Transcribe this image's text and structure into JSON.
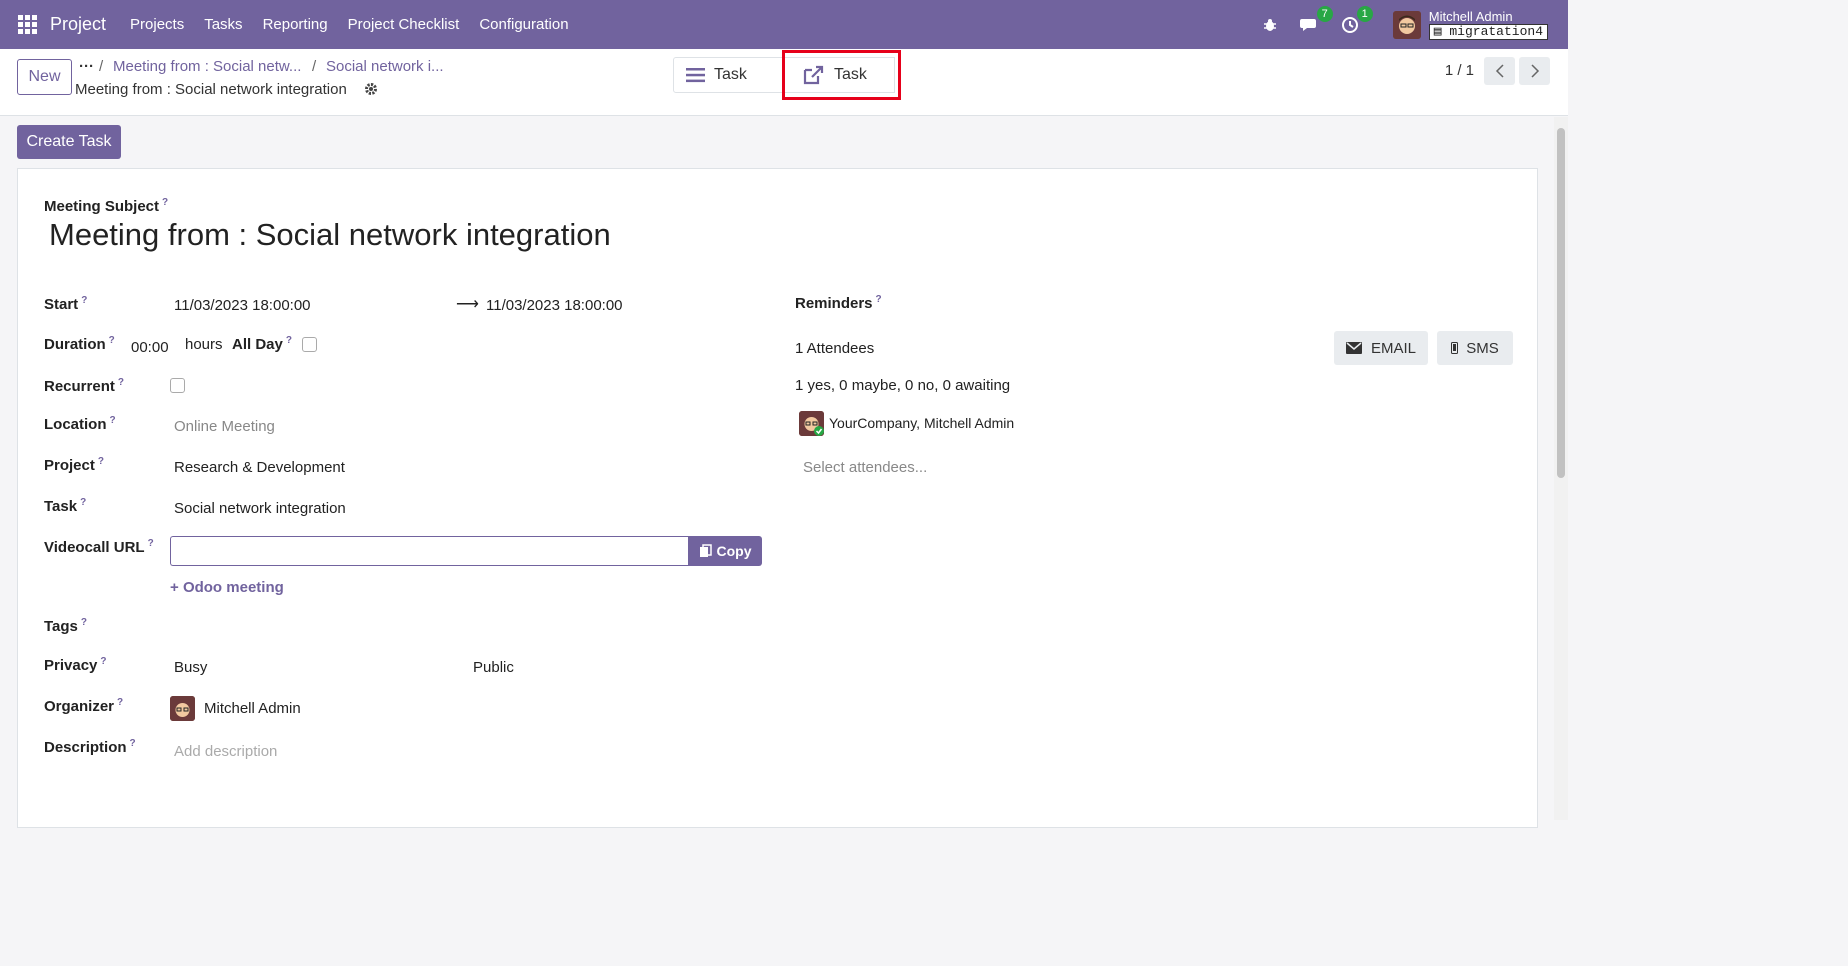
{
  "navbar": {
    "brand": "Project",
    "menu": [
      "Projects",
      "Tasks",
      "Reporting",
      "Project Checklist",
      "Configuration"
    ],
    "messages_count": "7",
    "activities_count": "1",
    "user_name": "Mitchell Admin",
    "database": "migratation4"
  },
  "control": {
    "new_label": "New",
    "breadcrumb": [
      "Meeting from : Social netw...",
      "Social network i..."
    ],
    "record_name": "Meeting from : Social network integration",
    "smart_buttons": [
      "Task",
      "Task"
    ],
    "pager": "1 / 1"
  },
  "actions": {
    "create_task": "Create Task"
  },
  "form": {
    "meeting_subject_label": "Meeting Subject",
    "title": "Meeting from : Social network integration",
    "start_label": "Start",
    "start_date": "11/03/2023 18:00:00",
    "end_date": "11/03/2023 18:00:00",
    "duration_label": "Duration",
    "duration_value": "00:00",
    "hours_label": "hours",
    "allday_label": "All Day",
    "recurrent_label": "Recurrent",
    "location_label": "Location",
    "location_placeholder": "Online Meeting",
    "project_label": "Project",
    "project_value": "Research & Development",
    "task_label": "Task",
    "task_value": "Social network integration",
    "videocall_label": "Videocall URL",
    "copy_label": "Copy",
    "odoo_meeting_label": "Odoo meeting",
    "tags_label": "Tags",
    "privacy_label": "Privacy",
    "privacy_show_as": "Busy",
    "privacy_value": "Public",
    "organizer_label": "Organizer",
    "organizer_value": "Mitchell Admin",
    "description_label": "Description",
    "description_placeholder": "Add description",
    "reminders_label": "Reminders",
    "attendees_count": "1 Attendees",
    "attendees_summary": "1 yes, 0 maybe, 0 no, 0 awaiting",
    "attendee_name": "YourCompany, Mitchell Admin",
    "select_attendees_placeholder": "Select attendees...",
    "email_label": "EMAIL",
    "sms_label": "SMS"
  },
  "colors": {
    "brand": "#71639e",
    "highlight": "#e6001a",
    "badge": "#28a745"
  }
}
